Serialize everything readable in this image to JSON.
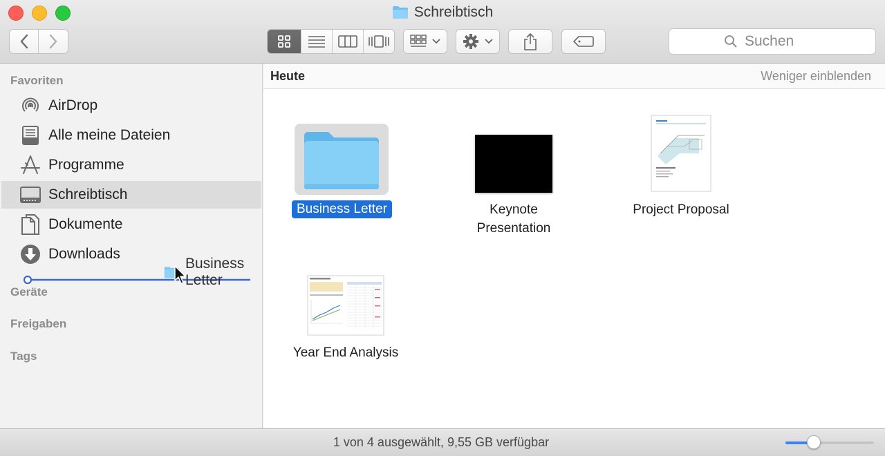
{
  "window": {
    "title": "Schreibtisch",
    "title_icon": "folder-icon"
  },
  "toolbar": {
    "back_icon": "chevron-left-icon",
    "forward_icon": "chevron-right-icon",
    "view_modes": [
      {
        "icon": "icon-view-grid-icon",
        "active": true
      },
      {
        "icon": "list-view-icon",
        "active": false
      },
      {
        "icon": "column-view-icon",
        "active": false
      },
      {
        "icon": "cover-flow-icon",
        "active": false
      }
    ],
    "arrange_icon": "arrange-grid-icon",
    "action_icon": "gear-icon",
    "share_icon": "share-icon",
    "tag_icon": "tag-icon",
    "search_placeholder": "Suchen"
  },
  "sidebar": {
    "sections": {
      "favorites": "Favoriten",
      "devices": "Geräte",
      "shared": "Freigaben",
      "tags": "Tags"
    },
    "items": [
      {
        "label": "AirDrop",
        "icon": "airdrop-icon",
        "selected": false
      },
      {
        "label": "Alle meine Dateien",
        "icon": "all-files-icon",
        "selected": false
      },
      {
        "label": "Programme",
        "icon": "applications-icon",
        "selected": false
      },
      {
        "label": "Schreibtisch",
        "icon": "desktop-icon",
        "selected": true
      },
      {
        "label": "Dokumente",
        "icon": "documents-icon",
        "selected": false
      },
      {
        "label": "Downloads",
        "icon": "downloads-icon",
        "selected": false
      }
    ],
    "drag_item_label": "Business Letter"
  },
  "main": {
    "group_title": "Heute",
    "group_action": "Weniger einblenden",
    "files": [
      {
        "label": "Business Letter",
        "kind": "folder",
        "selected": true
      },
      {
        "label": "Keynote\nPresentation",
        "kind": "keynote",
        "selected": false
      },
      {
        "label": "Project Proposal",
        "kind": "pages",
        "selected": false
      },
      {
        "label": "Year End Analysis",
        "kind": "numbers",
        "selected": false
      }
    ]
  },
  "status": {
    "text": "1 von 4 ausgewählt, 9,55 GB verfügbar",
    "zoom_level": 0.29
  },
  "colors": {
    "selection": "#1e6fd9",
    "folder": "#7cc8f5",
    "drop_indicator": "#3b66d0"
  }
}
